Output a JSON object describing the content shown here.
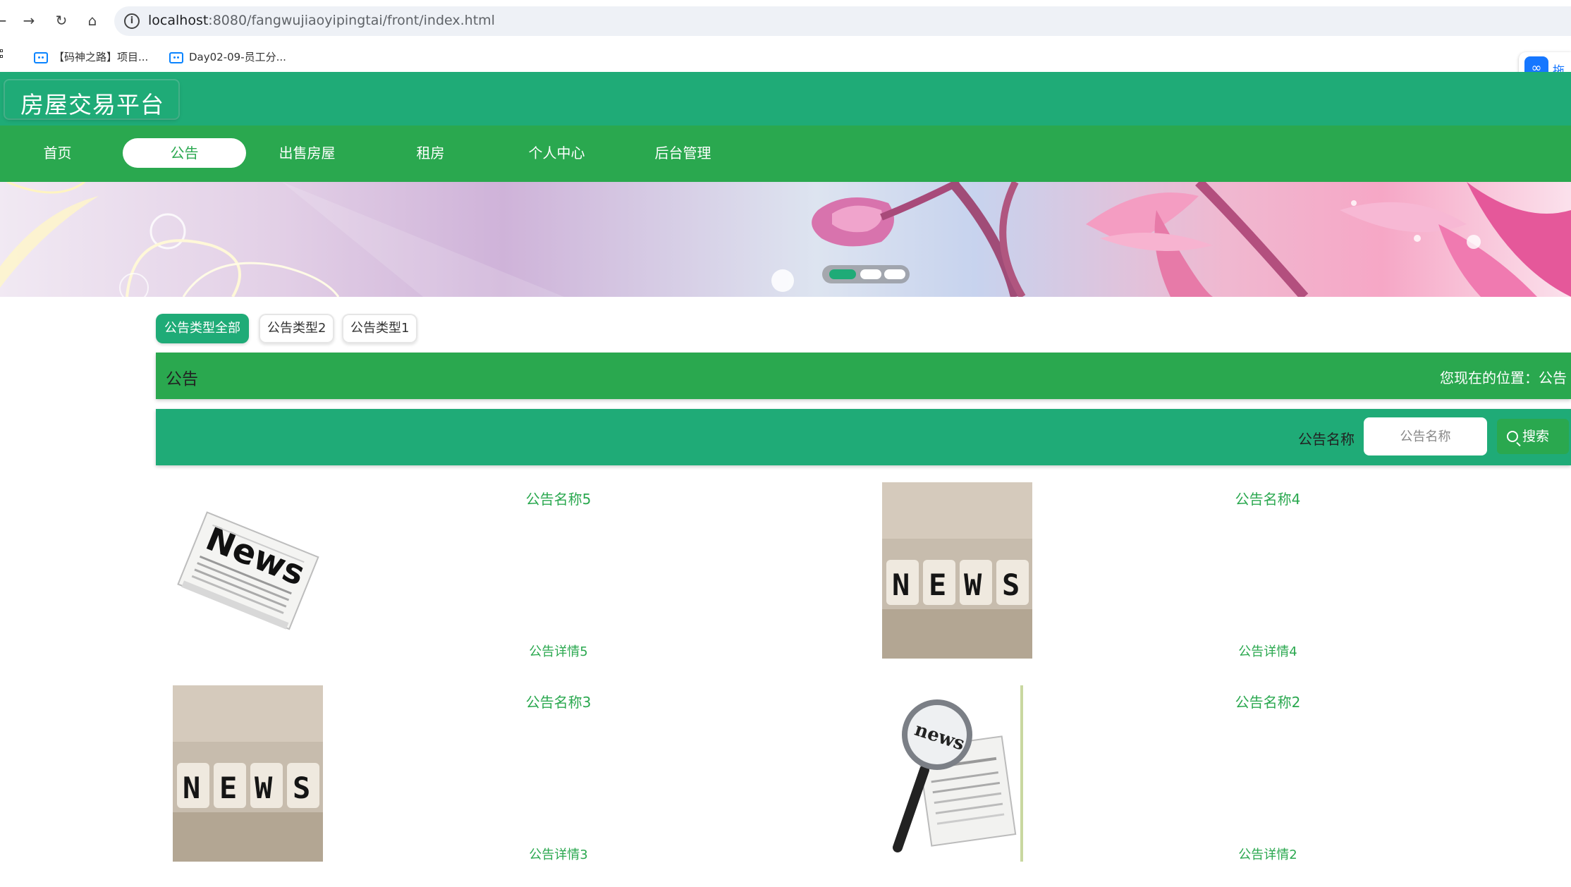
{
  "browser": {
    "url_host": "localhost",
    "url_rest": ":8080/fangwujiaoyipingtai/front/index.html",
    "bookmarks": [
      "【码神之路】项目...",
      "Day02-09-员工分..."
    ],
    "extension_label": "拖"
  },
  "site": {
    "logo": "房屋交易平台",
    "nav": [
      "首页",
      "公告",
      "出售房屋",
      "租房",
      "个人中心",
      "后台管理"
    ],
    "active_nav_index": 1
  },
  "category_tabs": [
    "公告类型全部",
    "公告类型2",
    "公告类型1"
  ],
  "page": {
    "title": "公告",
    "location_label": "您现在的位置：",
    "location_value": "公告"
  },
  "search": {
    "label": "公告名称",
    "placeholder": "公告名称",
    "button": "搜索"
  },
  "notices": [
    {
      "name": "公告名称5",
      "detail": "公告详情5",
      "image": "news-newspaper-icon"
    },
    {
      "name": "公告名称4",
      "detail": "公告详情4",
      "image": "news-blocks-icon"
    },
    {
      "name": "公告名称3",
      "detail": "公告详情3",
      "image": "news-blocks-icon"
    },
    {
      "name": "公告名称2",
      "detail": "公告详情2",
      "image": "news-magnifier-icon"
    }
  ],
  "colors": {
    "header": "#1fab77",
    "nav": "#2aa84f",
    "accent_text": "#2aa84f"
  }
}
